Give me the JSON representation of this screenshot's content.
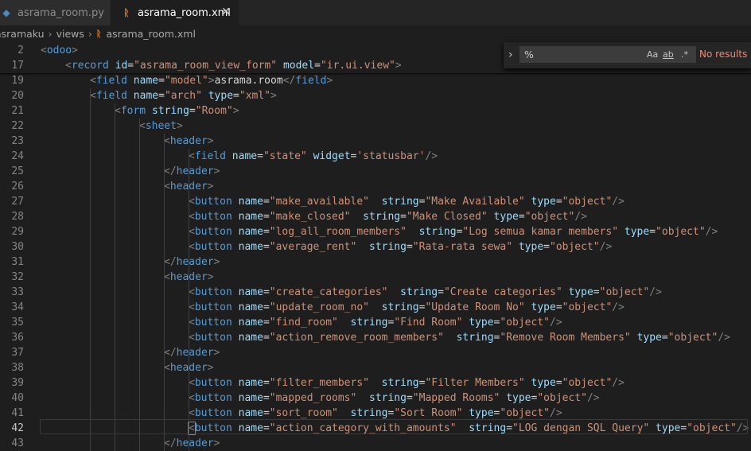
{
  "tabs": [
    {
      "label": "asrama_room.py",
      "active": false,
      "icon": "python-icon"
    },
    {
      "label": "asrama_room.xml",
      "active": true,
      "icon": "rss-xml-icon"
    }
  ],
  "breadcrumb": [
    "asramaku",
    "views",
    "asrama_room.xml"
  ],
  "find_widget": {
    "query": "%",
    "match_case": "Aa",
    "whole_word": "ab",
    "regex": ".*",
    "status": "No results"
  },
  "colors": {
    "tag": "#569cd6",
    "attribute": "#9cdcfe",
    "string": "#ce9178",
    "text": "#d4d4d4",
    "bracket": "#808080"
  },
  "lines": [
    {
      "no": "2",
      "indent": 0,
      "tokens": [
        [
          "br",
          "<"
        ],
        [
          "tag",
          "odoo"
        ],
        [
          "br",
          ">"
        ]
      ]
    },
    {
      "no": "17",
      "indent": 1,
      "tokens": [
        [
          "br",
          "<"
        ],
        [
          "tag",
          "record"
        ],
        [
          "txt",
          " "
        ],
        [
          "attr",
          "id"
        ],
        [
          "txt",
          "="
        ],
        [
          "str",
          "\"asrama_room_view_form\""
        ],
        [
          "txt",
          " "
        ],
        [
          "attr",
          "model"
        ],
        [
          "txt",
          "="
        ],
        [
          "str",
          "\"ir.ui.view\""
        ],
        [
          "br",
          ">"
        ]
      ]
    },
    {
      "no": "19",
      "indent": 2,
      "tokens": [
        [
          "br",
          "<"
        ],
        [
          "tag",
          "field"
        ],
        [
          "txt",
          " "
        ],
        [
          "attr",
          "name"
        ],
        [
          "txt",
          "="
        ],
        [
          "str",
          "\"model\""
        ],
        [
          "br",
          ">"
        ],
        [
          "txt",
          "asrama.room"
        ],
        [
          "br",
          "</"
        ],
        [
          "tag",
          "field"
        ],
        [
          "br",
          ">"
        ]
      ]
    },
    {
      "no": "20",
      "indent": 2,
      "tokens": [
        [
          "br",
          "<"
        ],
        [
          "tag",
          "field"
        ],
        [
          "txt",
          " "
        ],
        [
          "attr",
          "name"
        ],
        [
          "txt",
          "="
        ],
        [
          "str",
          "\"arch\""
        ],
        [
          "txt",
          " "
        ],
        [
          "attr",
          "type"
        ],
        [
          "txt",
          "="
        ],
        [
          "str",
          "\"xml\""
        ],
        [
          "br",
          ">"
        ]
      ]
    },
    {
      "no": "21",
      "indent": 3,
      "tokens": [
        [
          "br",
          "<"
        ],
        [
          "tag",
          "form"
        ],
        [
          "txt",
          " "
        ],
        [
          "attr",
          "string"
        ],
        [
          "txt",
          "="
        ],
        [
          "str",
          "\"Room\""
        ],
        [
          "br",
          ">"
        ]
      ]
    },
    {
      "no": "22",
      "indent": 4,
      "tokens": [
        [
          "br",
          "<"
        ],
        [
          "tag",
          "sheet"
        ],
        [
          "br",
          ">"
        ]
      ]
    },
    {
      "no": "23",
      "indent": 5,
      "tokens": [
        [
          "br",
          "<"
        ],
        [
          "tag",
          "header"
        ],
        [
          "br",
          ">"
        ]
      ]
    },
    {
      "no": "24",
      "indent": 6,
      "tokens": [
        [
          "br",
          "<"
        ],
        [
          "tag",
          "field"
        ],
        [
          "txt",
          " "
        ],
        [
          "attr",
          "name"
        ],
        [
          "txt",
          "="
        ],
        [
          "str",
          "\"state\""
        ],
        [
          "txt",
          " "
        ],
        [
          "attr",
          "widget"
        ],
        [
          "txt",
          "="
        ],
        [
          "str",
          "'statusbar'"
        ],
        [
          "br",
          "/>"
        ]
      ]
    },
    {
      "no": "25",
      "indent": 5,
      "tokens": [
        [
          "br",
          "</"
        ],
        [
          "tag",
          "header"
        ],
        [
          "br",
          ">"
        ]
      ]
    },
    {
      "no": "26",
      "indent": 5,
      "tokens": [
        [
          "br",
          "<"
        ],
        [
          "tag",
          "header"
        ],
        [
          "br",
          ">"
        ]
      ]
    },
    {
      "no": "27",
      "indent": 6,
      "tokens": [
        [
          "br",
          "<"
        ],
        [
          "tag",
          "button"
        ],
        [
          "txt",
          " "
        ],
        [
          "attr",
          "name"
        ],
        [
          "txt",
          "="
        ],
        [
          "str",
          "\"make_available\""
        ],
        [
          "txt",
          "  "
        ],
        [
          "attr",
          "string"
        ],
        [
          "txt",
          "="
        ],
        [
          "str",
          "\"Make Available\""
        ],
        [
          "txt",
          " "
        ],
        [
          "attr",
          "type"
        ],
        [
          "txt",
          "="
        ],
        [
          "str",
          "\"object\""
        ],
        [
          "br",
          "/>"
        ]
      ]
    },
    {
      "no": "28",
      "indent": 6,
      "tokens": [
        [
          "br",
          "<"
        ],
        [
          "tag",
          "button"
        ],
        [
          "txt",
          " "
        ],
        [
          "attr",
          "name"
        ],
        [
          "txt",
          "="
        ],
        [
          "str",
          "\"make_closed\""
        ],
        [
          "txt",
          "  "
        ],
        [
          "attr",
          "string"
        ],
        [
          "txt",
          "="
        ],
        [
          "str",
          "\"Make Closed\""
        ],
        [
          "txt",
          " "
        ],
        [
          "attr",
          "type"
        ],
        [
          "txt",
          "="
        ],
        [
          "str",
          "\"object\""
        ],
        [
          "br",
          "/>"
        ]
      ]
    },
    {
      "no": "29",
      "indent": 6,
      "tokens": [
        [
          "br",
          "<"
        ],
        [
          "tag",
          "button"
        ],
        [
          "txt",
          " "
        ],
        [
          "attr",
          "name"
        ],
        [
          "txt",
          "="
        ],
        [
          "str",
          "\"log_all_room_members\""
        ],
        [
          "txt",
          "  "
        ],
        [
          "attr",
          "string"
        ],
        [
          "txt",
          "="
        ],
        [
          "str",
          "\"Log semua kamar members\""
        ],
        [
          "txt",
          " "
        ],
        [
          "attr",
          "type"
        ],
        [
          "txt",
          "="
        ],
        [
          "str",
          "\"object\""
        ],
        [
          "br",
          "/>"
        ]
      ]
    },
    {
      "no": "30",
      "indent": 6,
      "tokens": [
        [
          "br",
          "<"
        ],
        [
          "tag",
          "button"
        ],
        [
          "txt",
          " "
        ],
        [
          "attr",
          "name"
        ],
        [
          "txt",
          "="
        ],
        [
          "str",
          "\"average_rent\""
        ],
        [
          "txt",
          "  "
        ],
        [
          "attr",
          "string"
        ],
        [
          "txt",
          "="
        ],
        [
          "str",
          "\"Rata-rata sewa\""
        ],
        [
          "txt",
          " "
        ],
        [
          "attr",
          "type"
        ],
        [
          "txt",
          "="
        ],
        [
          "str",
          "\"object\""
        ],
        [
          "br",
          "/>"
        ]
      ]
    },
    {
      "no": "31",
      "indent": 5,
      "tokens": [
        [
          "br",
          "</"
        ],
        [
          "tag",
          "header"
        ],
        [
          "br",
          ">"
        ]
      ]
    },
    {
      "no": "32",
      "indent": 5,
      "tokens": [
        [
          "br",
          "<"
        ],
        [
          "tag",
          "header"
        ],
        [
          "br",
          ">"
        ]
      ]
    },
    {
      "no": "33",
      "indent": 6,
      "tokens": [
        [
          "br",
          "<"
        ],
        [
          "tag",
          "button"
        ],
        [
          "txt",
          " "
        ],
        [
          "attr",
          "name"
        ],
        [
          "txt",
          "="
        ],
        [
          "str",
          "\"create_categories\""
        ],
        [
          "txt",
          "  "
        ],
        [
          "attr",
          "string"
        ],
        [
          "txt",
          "="
        ],
        [
          "str",
          "\"Create categories\""
        ],
        [
          "txt",
          " "
        ],
        [
          "attr",
          "type"
        ],
        [
          "txt",
          "="
        ],
        [
          "str",
          "\"object\""
        ],
        [
          "br",
          "/>"
        ]
      ]
    },
    {
      "no": "34",
      "indent": 6,
      "tokens": [
        [
          "br",
          "<"
        ],
        [
          "tag",
          "button"
        ],
        [
          "txt",
          " "
        ],
        [
          "attr",
          "name"
        ],
        [
          "txt",
          "="
        ],
        [
          "str",
          "\"update_room_no\""
        ],
        [
          "txt",
          "  "
        ],
        [
          "attr",
          "string"
        ],
        [
          "txt",
          "="
        ],
        [
          "str",
          "\"Update Room No\""
        ],
        [
          "txt",
          " "
        ],
        [
          "attr",
          "type"
        ],
        [
          "txt",
          "="
        ],
        [
          "str",
          "\"object\""
        ],
        [
          "br",
          "/>"
        ]
      ]
    },
    {
      "no": "35",
      "indent": 6,
      "tokens": [
        [
          "br",
          "<"
        ],
        [
          "tag",
          "button"
        ],
        [
          "txt",
          " "
        ],
        [
          "attr",
          "name"
        ],
        [
          "txt",
          "="
        ],
        [
          "str",
          "\"find_room\""
        ],
        [
          "txt",
          "  "
        ],
        [
          "attr",
          "string"
        ],
        [
          "txt",
          "="
        ],
        [
          "str",
          "\"Find Room\""
        ],
        [
          "txt",
          " "
        ],
        [
          "attr",
          "type"
        ],
        [
          "txt",
          "="
        ],
        [
          "str",
          "\"object\""
        ],
        [
          "br",
          "/>"
        ]
      ]
    },
    {
      "no": "36",
      "indent": 6,
      "tokens": [
        [
          "br",
          "<"
        ],
        [
          "tag",
          "button"
        ],
        [
          "txt",
          " "
        ],
        [
          "attr",
          "name"
        ],
        [
          "txt",
          "="
        ],
        [
          "str",
          "\"action_remove_room_members\""
        ],
        [
          "txt",
          "  "
        ],
        [
          "attr",
          "string"
        ],
        [
          "txt",
          "="
        ],
        [
          "str",
          "\"Remove Room Members\""
        ],
        [
          "txt",
          " "
        ],
        [
          "attr",
          "type"
        ],
        [
          "txt",
          "="
        ],
        [
          "str",
          "\"object\""
        ],
        [
          "br",
          "/>"
        ]
      ]
    },
    {
      "no": "37",
      "indent": 5,
      "tokens": [
        [
          "br",
          "</"
        ],
        [
          "tag",
          "header"
        ],
        [
          "br",
          ">"
        ]
      ]
    },
    {
      "no": "38",
      "indent": 5,
      "tokens": [
        [
          "br",
          "<"
        ],
        [
          "tag",
          "header"
        ],
        [
          "br",
          ">"
        ]
      ]
    },
    {
      "no": "39",
      "indent": 6,
      "tokens": [
        [
          "br",
          "<"
        ],
        [
          "tag",
          "button"
        ],
        [
          "txt",
          " "
        ],
        [
          "attr",
          "name"
        ],
        [
          "txt",
          "="
        ],
        [
          "str",
          "\"filter_members\""
        ],
        [
          "txt",
          "  "
        ],
        [
          "attr",
          "string"
        ],
        [
          "txt",
          "="
        ],
        [
          "str",
          "\"Filter Members\""
        ],
        [
          "txt",
          " "
        ],
        [
          "attr",
          "type"
        ],
        [
          "txt",
          "="
        ],
        [
          "str",
          "\"object\""
        ],
        [
          "br",
          "/>"
        ]
      ]
    },
    {
      "no": "40",
      "indent": 6,
      "tokens": [
        [
          "br",
          "<"
        ],
        [
          "tag",
          "button"
        ],
        [
          "txt",
          " "
        ],
        [
          "attr",
          "name"
        ],
        [
          "txt",
          "="
        ],
        [
          "str",
          "\"mapped_rooms\""
        ],
        [
          "txt",
          "  "
        ],
        [
          "attr",
          "string"
        ],
        [
          "txt",
          "="
        ],
        [
          "str",
          "\"Mapped Rooms\""
        ],
        [
          "txt",
          " "
        ],
        [
          "attr",
          "type"
        ],
        [
          "txt",
          "="
        ],
        [
          "str",
          "\"object\""
        ],
        [
          "br",
          "/>"
        ]
      ]
    },
    {
      "no": "41",
      "indent": 6,
      "tokens": [
        [
          "br",
          "<"
        ],
        [
          "tag",
          "button"
        ],
        [
          "txt",
          " "
        ],
        [
          "attr",
          "name"
        ],
        [
          "txt",
          "="
        ],
        [
          "str",
          "\"sort_room\""
        ],
        [
          "txt",
          "  "
        ],
        [
          "attr",
          "string"
        ],
        [
          "txt",
          "="
        ],
        [
          "str",
          "\"Sort Room\""
        ],
        [
          "txt",
          " "
        ],
        [
          "attr",
          "type"
        ],
        [
          "txt",
          "="
        ],
        [
          "str",
          "\"object\""
        ],
        [
          "br",
          "/>"
        ]
      ]
    },
    {
      "no": "42",
      "indent": 6,
      "current": true,
      "tokens": [
        [
          "br",
          "<"
        ],
        [
          "tag",
          "button"
        ],
        [
          "txt",
          " "
        ],
        [
          "attr",
          "name"
        ],
        [
          "txt",
          "="
        ],
        [
          "str",
          "\"action_category_with_amounts\""
        ],
        [
          "txt",
          "  "
        ],
        [
          "attr",
          "string"
        ],
        [
          "txt",
          "="
        ],
        [
          "str",
          "\"LOG dengan SQL Query\""
        ],
        [
          "txt",
          " "
        ],
        [
          "attr",
          "type"
        ],
        [
          "txt",
          "="
        ],
        [
          "str",
          "\"object\""
        ],
        [
          "br",
          "/>"
        ]
      ]
    },
    {
      "no": "43",
      "indent": 5,
      "tokens": [
        [
          "br",
          "</"
        ],
        [
          "tag",
          "header"
        ],
        [
          "br",
          ">"
        ]
      ]
    }
  ]
}
